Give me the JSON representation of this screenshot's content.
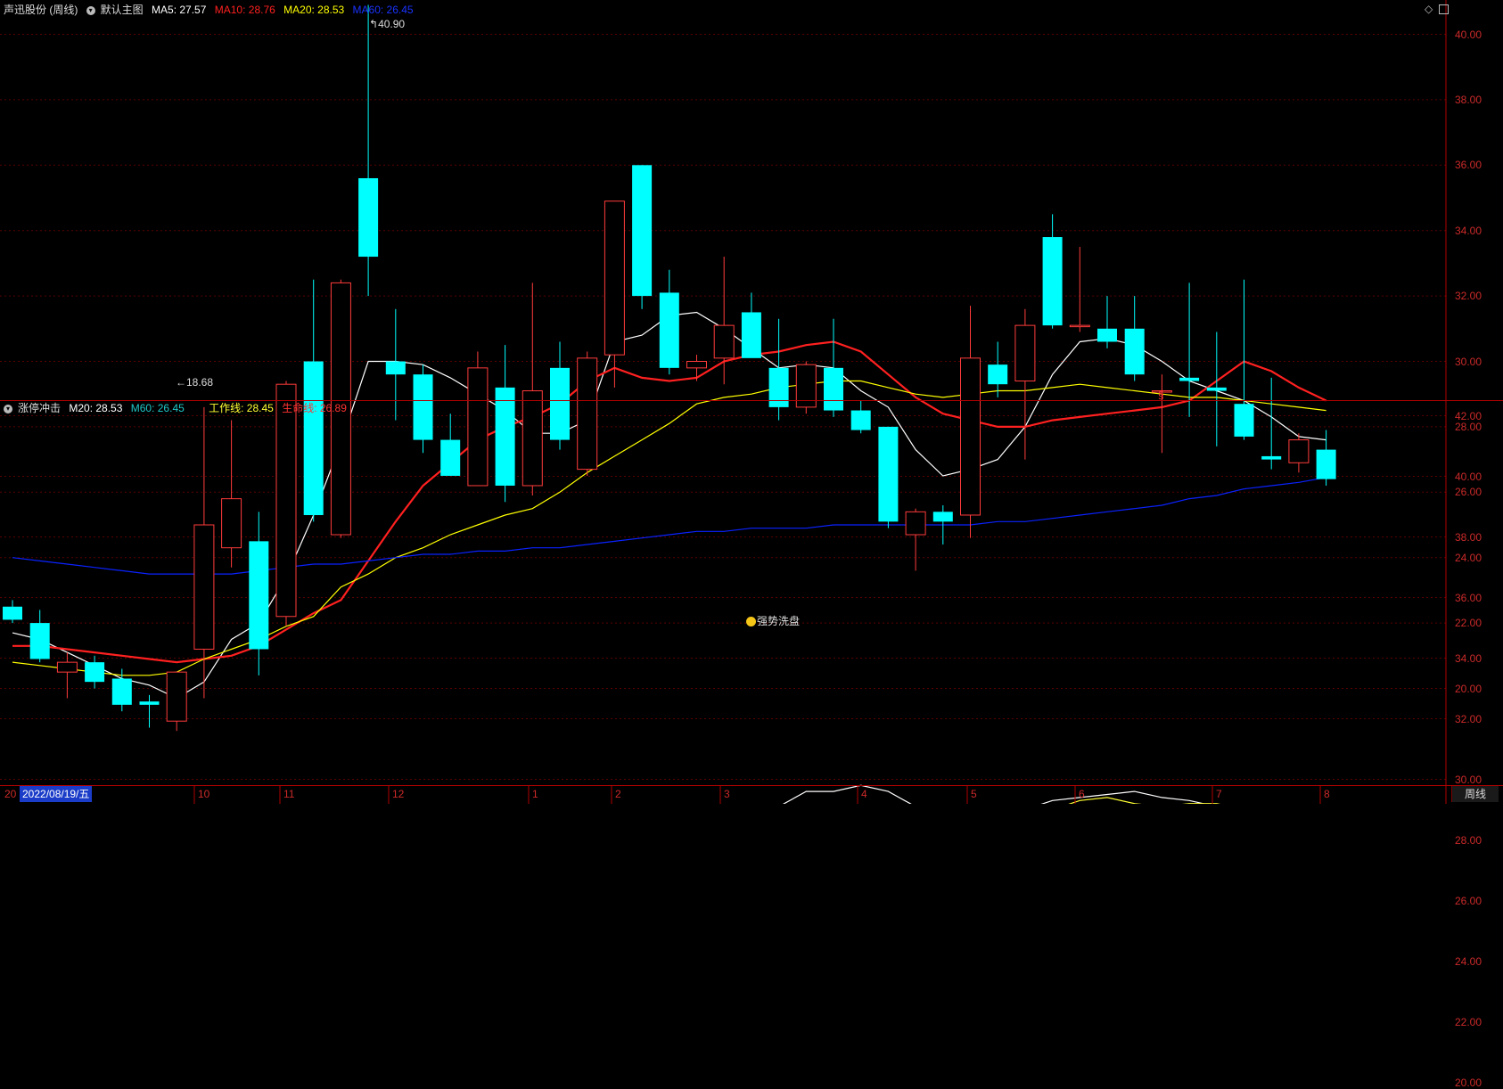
{
  "top": {
    "stock": "声迅股份 (周线)",
    "main_chart_name": "默认主图",
    "ma5_label": "MA5: 27.57",
    "ma10_label": "MA10: 28.76",
    "ma20_label": "MA20: 28.53",
    "ma60_label": "MA60: 26.45"
  },
  "sub": {
    "indicator_name": "涨停冲击",
    "m20_label": "M20: 28.53",
    "m60_label": "M60: 26.45",
    "work_label": "工作线: 28.45",
    "life_label": "生命线: 26.89",
    "signal_text": "强势洗盘"
  },
  "annotations": {
    "high": "40.90",
    "low": "18.68",
    "marker": "§"
  },
  "footer": {
    "date": "2022/08/19/五",
    "year_prefix": "20",
    "period_tab": "周线"
  },
  "colors": {
    "up": "#ff3b3b",
    "down": "#00ffff",
    "ma5": "#ffffff",
    "ma10": "#ff2020",
    "ma20": "#ffff00",
    "ma60": "#0a22ff",
    "axis": "#cc2a2a"
  },
  "icons": [
    "diamond-icon",
    "expand-icon"
  ],
  "chart_data": [
    {
      "type": "candlestick",
      "title": "声迅股份 (周线)",
      "ylim": [
        18,
        41
      ],
      "y_ticks": [
        "20.00",
        "22.00",
        "24.00",
        "26.00",
        "28.00",
        "30.00",
        "32.00",
        "34.00",
        "36.00",
        "38.00",
        "40.00"
      ],
      "x_ticks": [
        "10",
        "11",
        "12",
        "1",
        "2",
        "3",
        "4",
        "5",
        "6",
        "7",
        "8"
      ],
      "candles": [
        {
          "o": 22.5,
          "h": 22.7,
          "l": 22.0,
          "c": 22.1
        },
        {
          "o": 22.0,
          "h": 22.4,
          "l": 20.8,
          "c": 20.9
        },
        {
          "o": 20.5,
          "h": 21.1,
          "l": 19.7,
          "c": 20.8
        },
        {
          "o": 20.8,
          "h": 21.0,
          "l": 20.0,
          "c": 20.2
        },
        {
          "o": 20.3,
          "h": 20.6,
          "l": 19.3,
          "c": 19.5
        },
        {
          "o": 19.6,
          "h": 19.8,
          "l": 18.8,
          "c": 19.5
        },
        {
          "o": 19.0,
          "h": 20.5,
          "l": 18.7,
          "c": 20.5
        },
        {
          "o": 21.2,
          "h": 28.6,
          "l": 19.7,
          "c": 25.0
        },
        {
          "o": 24.3,
          "h": 28.2,
          "l": 23.7,
          "c": 25.8
        },
        {
          "o": 24.5,
          "h": 25.4,
          "l": 20.4,
          "c": 21.2
        },
        {
          "o": 22.2,
          "h": 29.4,
          "l": 21.9,
          "c": 29.3
        },
        {
          "o": 30.0,
          "h": 32.5,
          "l": 25.1,
          "c": 25.3
        },
        {
          "o": 24.7,
          "h": 32.5,
          "l": 24.6,
          "c": 32.4
        },
        {
          "o": 35.6,
          "h": 40.9,
          "l": 32.0,
          "c": 33.2
        },
        {
          "o": 30.0,
          "h": 31.6,
          "l": 28.2,
          "c": 29.6
        },
        {
          "o": 29.6,
          "h": 29.9,
          "l": 27.2,
          "c": 27.6
        },
        {
          "o": 27.6,
          "h": 28.4,
          "l": 26.5,
          "c": 26.5
        },
        {
          "o": 26.2,
          "h": 30.3,
          "l": 26.2,
          "c": 29.8
        },
        {
          "o": 29.2,
          "h": 30.5,
          "l": 25.7,
          "c": 26.2
        },
        {
          "o": 26.2,
          "h": 32.4,
          "l": 25.9,
          "c": 29.1
        },
        {
          "o": 29.8,
          "h": 30.6,
          "l": 27.3,
          "c": 27.6
        },
        {
          "o": 26.7,
          "h": 30.3,
          "l": 26.5,
          "c": 30.1
        },
        {
          "o": 30.2,
          "h": 34.9,
          "l": 29.2,
          "c": 34.9
        },
        {
          "o": 36.0,
          "h": 36.0,
          "l": 31.6,
          "c": 32.0
        },
        {
          "o": 32.1,
          "h": 32.8,
          "l": 29.6,
          "c": 29.8
        },
        {
          "o": 29.8,
          "h": 30.2,
          "l": 29.4,
          "c": 30.0
        },
        {
          "o": 30.1,
          "h": 33.2,
          "l": 29.3,
          "c": 31.1
        },
        {
          "o": 31.5,
          "h": 32.1,
          "l": 30.2,
          "c": 30.1
        },
        {
          "o": 29.8,
          "h": 31.3,
          "l": 28.2,
          "c": 28.6
        },
        {
          "o": 28.6,
          "h": 30.0,
          "l": 28.4,
          "c": 29.9
        },
        {
          "o": 29.8,
          "h": 31.3,
          "l": 28.3,
          "c": 28.5
        },
        {
          "o": 28.5,
          "h": 28.8,
          "l": 27.8,
          "c": 27.9
        },
        {
          "o": 28.0,
          "h": 28.0,
          "l": 24.9,
          "c": 25.1
        },
        {
          "o": 24.7,
          "h": 25.5,
          "l": 23.6,
          "c": 25.4
        },
        {
          "o": 25.4,
          "h": 25.6,
          "l": 24.4,
          "c": 25.1
        },
        {
          "o": 25.3,
          "h": 31.7,
          "l": 24.6,
          "c": 30.1
        },
        {
          "o": 29.9,
          "h": 30.6,
          "l": 28.9,
          "c": 29.3
        },
        {
          "o": 29.4,
          "h": 31.6,
          "l": 27.0,
          "c": 31.1
        },
        {
          "o": 33.8,
          "h": 34.5,
          "l": 31.0,
          "c": 31.1
        },
        {
          "o": 31.1,
          "h": 33.5,
          "l": 30.9,
          "c": 31.1
        },
        {
          "o": 31.0,
          "h": 32.0,
          "l": 30.4,
          "c": 30.6
        },
        {
          "o": 31.0,
          "h": 32.0,
          "l": 29.4,
          "c": 29.6
        },
        {
          "o": 29.1,
          "h": 29.6,
          "l": 27.2,
          "c": 29.1
        },
        {
          "o": 29.5,
          "h": 32.4,
          "l": 28.3,
          "c": 29.4
        },
        {
          "o": 29.2,
          "h": 30.9,
          "l": 27.4,
          "c": 29.1
        },
        {
          "o": 28.7,
          "h": 32.5,
          "l": 27.6,
          "c": 27.7
        },
        {
          "o": 27.1,
          "h": 29.5,
          "l": 26.7,
          "c": 27.0
        },
        {
          "o": 26.9,
          "h": 27.8,
          "l": 26.6,
          "c": 27.6
        },
        {
          "o": 27.3,
          "h": 27.9,
          "l": 26.2,
          "c": 26.4
        }
      ],
      "series": [
        {
          "name": "MA5",
          "color": "#ffffff",
          "values": [
            21.7,
            21.5,
            21.1,
            20.7,
            20.3,
            20.1,
            19.7,
            20.2,
            21.5,
            22.0,
            23.4,
            25.3,
            27.5,
            30.0,
            30.0,
            29.9,
            29.5,
            29.0,
            28.5,
            27.8,
            27.8,
            28.2,
            30.6,
            30.8,
            31.4,
            31.5,
            31.0,
            30.4,
            29.8,
            29.9,
            29.8,
            29.1,
            28.6,
            27.3,
            26.5,
            26.7,
            27.0,
            28.0,
            29.6,
            30.6,
            30.7,
            30.5,
            30.0,
            29.4,
            29.1,
            28.8,
            28.3,
            27.7,
            27.6
          ]
        },
        {
          "name": "MA10",
          "color": "#ff2020",
          "values": [
            21.3,
            21.3,
            21.2,
            21.1,
            21.0,
            20.9,
            20.8,
            20.9,
            21.0,
            21.3,
            21.8,
            22.3,
            22.7,
            23.9,
            25.1,
            26.2,
            26.9,
            27.6,
            28.0,
            28.3,
            28.7,
            29.4,
            29.8,
            29.5,
            29.4,
            29.5,
            30.0,
            30.2,
            30.3,
            30.5,
            30.6,
            30.3,
            29.6,
            28.9,
            28.4,
            28.2,
            28.0,
            28.0,
            28.2,
            28.3,
            28.4,
            28.5,
            28.6,
            28.8,
            29.4,
            30.0,
            29.7,
            29.2,
            28.8
          ]
        },
        {
          "name": "MA20",
          "color": "#ffff00",
          "values": [
            20.8,
            20.7,
            20.6,
            20.5,
            20.4,
            20.4,
            20.5,
            20.9,
            21.2,
            21.5,
            21.9,
            22.2,
            23.1,
            23.5,
            24.0,
            24.3,
            24.7,
            25.0,
            25.3,
            25.5,
            26.0,
            26.6,
            27.1,
            27.6,
            28.1,
            28.7,
            28.9,
            29.0,
            29.2,
            29.3,
            29.4,
            29.4,
            29.2,
            29.0,
            28.9,
            29.0,
            29.1,
            29.1,
            29.2,
            29.3,
            29.2,
            29.1,
            29.0,
            28.9,
            28.9,
            28.8,
            28.7,
            28.6,
            28.5
          ]
        },
        {
          "name": "MA60",
          "color": "#0a22ff",
          "values": [
            24.0,
            23.9,
            23.8,
            23.7,
            23.6,
            23.5,
            23.5,
            23.5,
            23.5,
            23.6,
            23.7,
            23.8,
            23.8,
            23.9,
            24.0,
            24.1,
            24.1,
            24.2,
            24.2,
            24.3,
            24.3,
            24.4,
            24.5,
            24.6,
            24.7,
            24.8,
            24.8,
            24.9,
            24.9,
            24.9,
            25.0,
            25.0,
            25.0,
            25.0,
            25.0,
            25.0,
            25.1,
            25.1,
            25.2,
            25.3,
            25.4,
            25.5,
            25.6,
            25.8,
            25.9,
            26.1,
            26.2,
            26.3,
            26.45
          ]
        }
      ]
    },
    {
      "type": "line",
      "title": "涨停冲击",
      "ylim": [
        19,
        43
      ],
      "y_ticks": [
        "20.00",
        "22.00",
        "24.00",
        "26.00",
        "28.00",
        "30.00",
        "32.00",
        "34.00",
        "36.00",
        "38.00",
        "40.00",
        "42.00"
      ],
      "signal_bar": {
        "index": 7,
        "o": 21.2,
        "c": 25.0,
        "h": 28.6,
        "l": 19.7
      },
      "signal_label_index": 26,
      "series": [
        {
          "name": "M20",
          "color": "#ffffff",
          "values": [
            20.8,
            20.7,
            20.6,
            20.5,
            20.5,
            20.5,
            20.6,
            20.8,
            21.1,
            21.2,
            21.7,
            21.9,
            22.5,
            23.1,
            23.5,
            23.9,
            24.2,
            24.6,
            24.9,
            25.2,
            25.5,
            25.8,
            26.5,
            27.1,
            27.6,
            28.1,
            28.8,
            29.0,
            29.1,
            29.6,
            29.6,
            29.8,
            29.6,
            29.1,
            28.9,
            28.8,
            29.0,
            29.0,
            29.3,
            29.4,
            29.5,
            29.6,
            29.4,
            29.3,
            29.1,
            29.0,
            28.8,
            28.6,
            28.5
          ]
        },
        {
          "name": "M60",
          "color": "#20c8c8",
          "values": [
            24.0,
            23.9,
            23.8,
            23.7,
            23.6,
            23.5,
            23.4,
            23.4,
            23.4,
            23.4,
            23.5,
            23.6,
            23.7,
            23.8,
            23.9,
            24.0,
            24.0,
            24.1,
            24.2,
            24.3,
            24.3,
            24.4,
            24.5,
            24.5,
            24.6,
            24.7,
            24.7,
            24.7,
            24.8,
            24.8,
            24.9,
            24.9,
            24.9,
            24.9,
            24.9,
            25.0,
            25.0,
            25.1,
            25.1,
            25.2,
            25.3,
            25.4,
            25.5,
            25.6,
            25.7,
            25.9,
            26.1,
            26.3,
            26.45
          ]
        },
        {
          "name": "工作线",
          "color": "#ffff33",
          "values": [
            21.5,
            21.4,
            21.3,
            21.1,
            20.9,
            20.8,
            20.8,
            21.2,
            21.8,
            21.7,
            22.4,
            22.8,
            23.8,
            25.0,
            25.5,
            25.8,
            26.0,
            26.3,
            26.5,
            26.7,
            27.0,
            27.3,
            28.0,
            28.4,
            28.6,
            28.8,
            29.0,
            29.0,
            29.1,
            29.1,
            29.1,
            29.0,
            28.7,
            28.3,
            27.9,
            28.1,
            28.3,
            28.7,
            29.0,
            29.3,
            29.4,
            29.2,
            29.1,
            29.2,
            29.2,
            29.0,
            28.8,
            28.6,
            28.45
          ]
        },
        {
          "name": "生命线",
          "color": "#ff3333",
          "values": [
            23.8,
            23.8,
            23.7,
            23.6,
            23.5,
            23.4,
            23.3,
            23.3,
            23.2,
            23.2,
            23.3,
            23.4,
            23.5,
            23.6,
            23.7,
            23.8,
            23.9,
            24.0,
            24.1,
            24.2,
            24.3,
            24.3,
            24.4,
            24.5,
            24.5,
            24.6,
            24.6,
            24.7,
            24.7,
            24.8,
            24.8,
            24.8,
            24.8,
            24.8,
            24.8,
            24.9,
            25.0,
            25.1,
            25.2,
            25.4,
            25.6,
            25.8,
            26.0,
            26.2,
            26.3,
            26.5,
            26.6,
            26.8,
            26.89
          ]
        }
      ]
    }
  ]
}
